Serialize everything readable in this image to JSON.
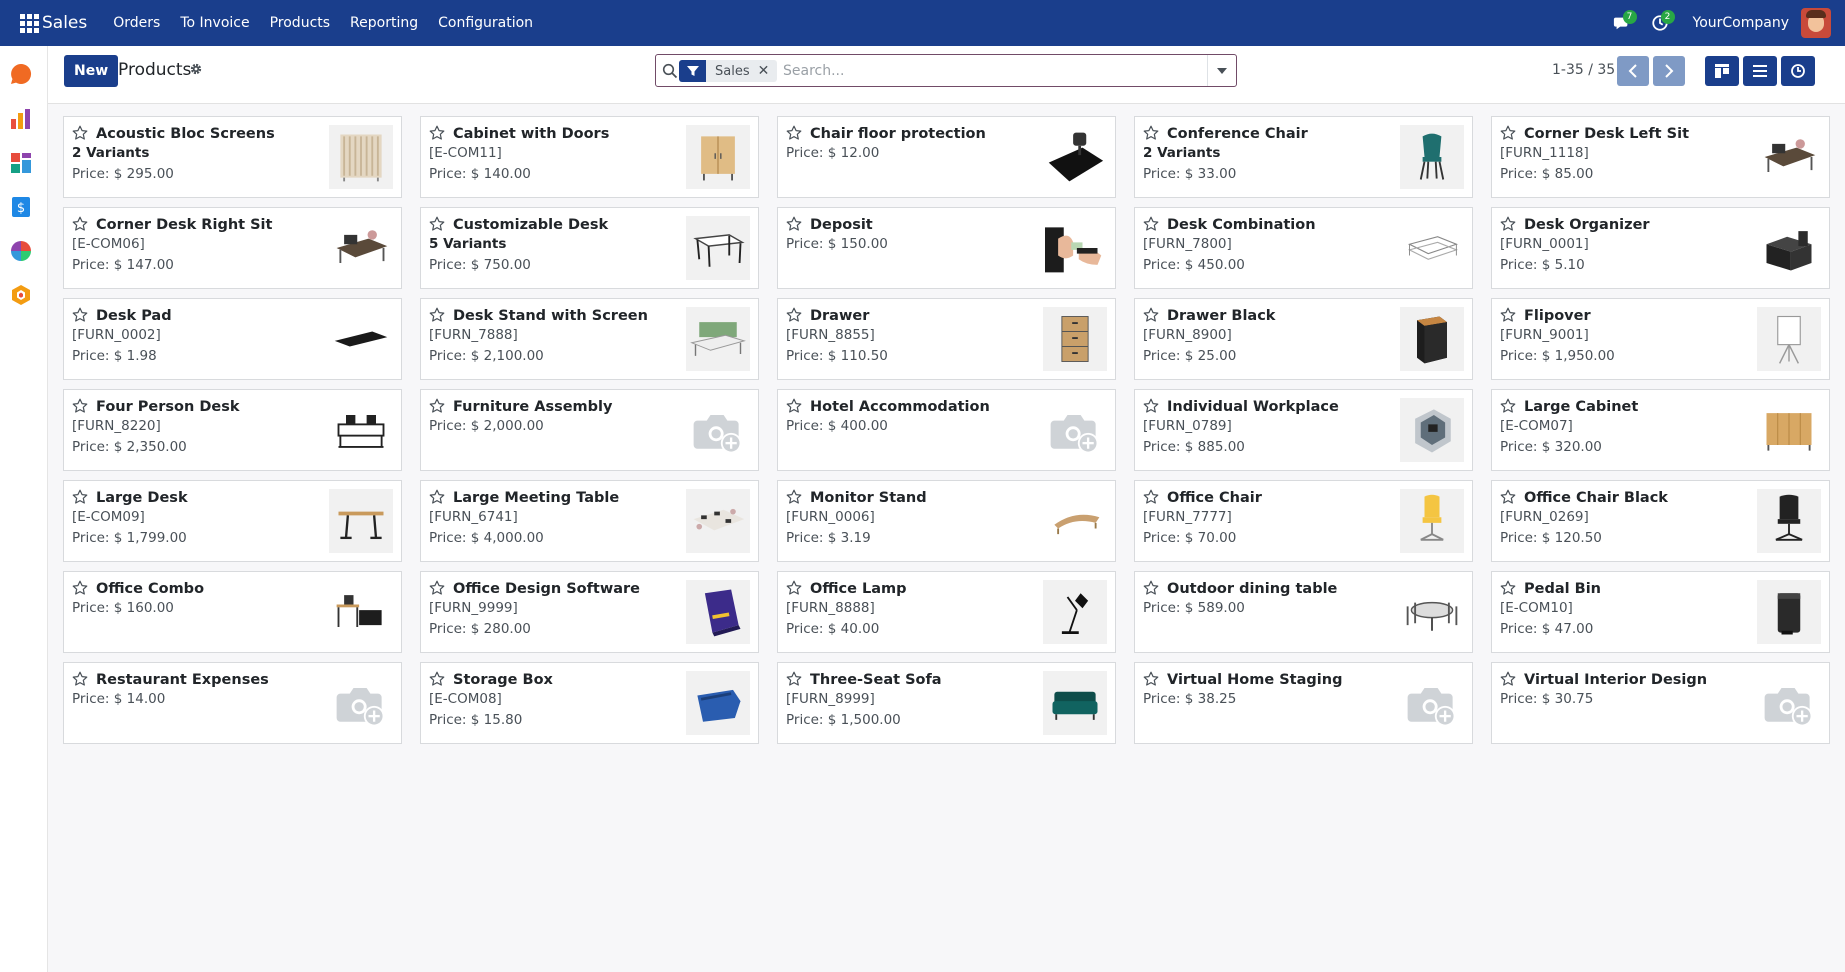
{
  "navbar": {
    "app_name": "Sales",
    "menu": [
      "Orders",
      "To Invoice",
      "Products",
      "Reporting",
      "Configuration"
    ],
    "messages_count": "7",
    "activities_count": "2",
    "company": "YourCompany"
  },
  "control": {
    "new_label": "New",
    "title": "Products",
    "facet_label": "Sales",
    "search_placeholder": "Search...",
    "pager": "1-35 / 35"
  },
  "colors": {
    "navbar": "#1a3e8c",
    "accent": "#714b67",
    "badge": "#28a745"
  },
  "products": [
    {
      "name": "Acoustic Bloc Screens",
      "sub": "2 Variants",
      "sub_bold": true,
      "price": "Price: $ 295.00",
      "icon": "screen-panels-icon"
    },
    {
      "name": "Cabinet with Doors",
      "sub": "[E-COM11]",
      "sub_bold": false,
      "price": "Price: $ 140.00",
      "icon": "cabinet-icon"
    },
    {
      "name": "Chair floor protection",
      "sub": "",
      "sub_bold": false,
      "price": "Price: $ 12.00",
      "icon": "floor-mat-icon"
    },
    {
      "name": "Conference Chair",
      "sub": "2 Variants",
      "sub_bold": true,
      "price": "Price: $ 33.00",
      "icon": "chair-icon"
    },
    {
      "name": "Corner Desk Left Sit",
      "sub": "[FURN_1118]",
      "sub_bold": false,
      "price": "Price: $ 85.00",
      "icon": "desk-icon"
    },
    {
      "name": "Corner Desk Right Sit",
      "sub": "[E-COM06]",
      "sub_bold": false,
      "price": "Price: $ 147.00",
      "icon": "desk-icon"
    },
    {
      "name": "Customizable Desk",
      "sub": "5 Variants",
      "sub_bold": true,
      "price": "Price: $ 750.00",
      "icon": "table-icon"
    },
    {
      "name": "Deposit",
      "sub": "",
      "sub_bold": false,
      "price": "Price: $ 150.00",
      "icon": "money-hand-icon"
    },
    {
      "name": "Desk Combination",
      "sub": "[FURN_7800]",
      "sub_bold": false,
      "price": "Price: $ 450.00",
      "icon": "desk-frame-icon"
    },
    {
      "name": "Desk Organizer",
      "sub": "[FURN_0001]",
      "sub_bold": false,
      "price": "Price: $ 5.10",
      "icon": "organizer-icon"
    },
    {
      "name": "Desk Pad",
      "sub": "[FURN_0002]",
      "sub_bold": false,
      "price": "Price: $ 1.98",
      "icon": "desk-pad-icon"
    },
    {
      "name": "Desk Stand with Screen",
      "sub": "[FURN_7888]",
      "sub_bold": false,
      "price": "Price: $ 2,100.00",
      "icon": "desk-screen-icon"
    },
    {
      "name": "Drawer",
      "sub": "[FURN_8855]",
      "sub_bold": false,
      "price": "Price: $ 110.50",
      "icon": "drawer-icon"
    },
    {
      "name": "Drawer Black",
      "sub": "[FURN_8900]",
      "sub_bold": false,
      "price": "Price: $ 25.00",
      "icon": "drawer-black-icon"
    },
    {
      "name": "Flipover",
      "sub": "[FURN_9001]",
      "sub_bold": false,
      "price": "Price: $ 1,950.00",
      "icon": "flipchart-icon"
    },
    {
      "name": "Four Person Desk",
      "sub": "[FURN_8220]",
      "sub_bold": false,
      "price": "Price: $ 2,350.00",
      "icon": "four-desk-icon"
    },
    {
      "name": "Furniture Assembly",
      "sub": "",
      "sub_bold": false,
      "price": "Price: $ 2,000.00",
      "icon": "camera-placeholder-icon"
    },
    {
      "name": "Hotel Accommodation",
      "sub": "",
      "sub_bold": false,
      "price": "Price: $ 400.00",
      "icon": "camera-placeholder-icon"
    },
    {
      "name": "Individual Workplace",
      "sub": "[FURN_0789]",
      "sub_bold": false,
      "price": "Price: $ 885.00",
      "icon": "workplace-icon"
    },
    {
      "name": "Large Cabinet",
      "sub": "[E-COM07]",
      "sub_bold": false,
      "price": "Price: $ 320.00",
      "icon": "large-cabinet-icon"
    },
    {
      "name": "Large Desk",
      "sub": "[E-COM09]",
      "sub_bold": false,
      "price": "Price: $ 1,799.00",
      "icon": "large-desk-icon"
    },
    {
      "name": "Large Meeting Table",
      "sub": "[FURN_6741]",
      "sub_bold": false,
      "price": "Price: $ 4,000.00",
      "icon": "meeting-table-icon"
    },
    {
      "name": "Monitor Stand",
      "sub": "[FURN_0006]",
      "sub_bold": false,
      "price": "Price: $ 3.19",
      "icon": "monitor-stand-icon"
    },
    {
      "name": "Office Chair",
      "sub": "[FURN_7777]",
      "sub_bold": false,
      "price": "Price: $ 70.00",
      "icon": "office-chair-icon"
    },
    {
      "name": "Office Chair Black",
      "sub": "[FURN_0269]",
      "sub_bold": false,
      "price": "Price: $ 120.50",
      "icon": "office-chair-black-icon"
    },
    {
      "name": "Office Combo",
      "sub": "",
      "sub_bold": false,
      "price": "Price: $ 160.00",
      "icon": "office-combo-icon"
    },
    {
      "name": "Office Design Software",
      "sub": "[FURN_9999]",
      "sub_bold": false,
      "price": "Price: $ 280.00",
      "icon": "software-box-icon"
    },
    {
      "name": "Office Lamp",
      "sub": "[FURN_8888]",
      "sub_bold": false,
      "price": "Price: $ 40.00",
      "icon": "lamp-icon"
    },
    {
      "name": "Outdoor dining table",
      "sub": "",
      "sub_bold": false,
      "price": "Price: $ 589.00",
      "icon": "dining-table-icon"
    },
    {
      "name": "Pedal Bin",
      "sub": "[E-COM10]",
      "sub_bold": false,
      "price": "Price: $ 47.00",
      "icon": "bin-icon"
    },
    {
      "name": "Restaurant Expenses",
      "sub": "",
      "sub_bold": false,
      "price": "Price: $ 14.00",
      "icon": "camera-placeholder-icon"
    },
    {
      "name": "Storage Box",
      "sub": "[E-COM08]",
      "sub_bold": false,
      "price": "Price: $ 15.80",
      "icon": "storage-box-icon"
    },
    {
      "name": "Three-Seat Sofa",
      "sub": "[FURN_8999]",
      "sub_bold": false,
      "price": "Price: $ 1,500.00",
      "icon": "sofa-icon"
    },
    {
      "name": "Virtual Home Staging",
      "sub": "",
      "sub_bold": false,
      "price": "Price: $ 38.25",
      "icon": "camera-placeholder-icon"
    },
    {
      "name": "Virtual Interior Design",
      "sub": "",
      "sub_bold": false,
      "price": "Price: $ 30.75",
      "icon": "camera-placeholder-icon"
    }
  ]
}
